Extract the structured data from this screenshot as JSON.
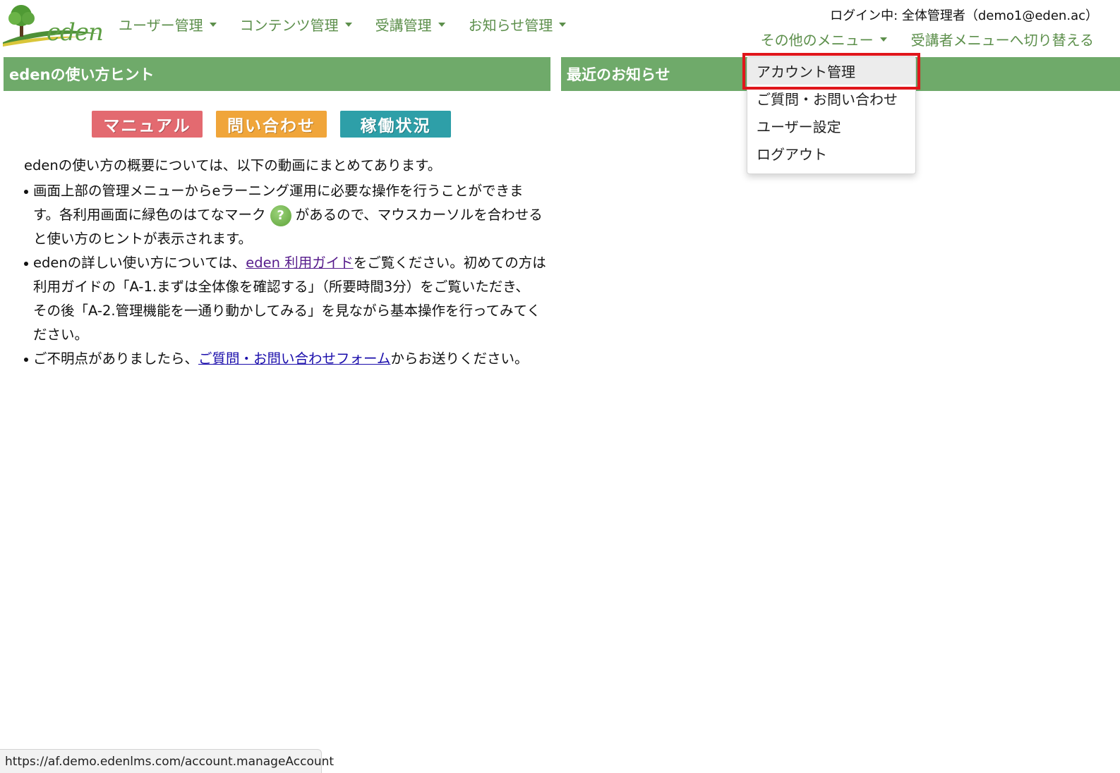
{
  "header": {
    "logo_text": "eden",
    "nav": [
      {
        "label": "ユーザー管理"
      },
      {
        "label": "コンテンツ管理"
      },
      {
        "label": "受講管理"
      },
      {
        "label": "お知らせ管理"
      }
    ],
    "login_status": "ログイン中: 全体管理者（demo1@eden.ac）",
    "other_menu_label": "その他のメニュー",
    "switch_menu_label": "受講者メニューへ切り替える"
  },
  "dropdown": {
    "items": [
      {
        "label": "アカウント管理"
      },
      {
        "label": "ご質問・お問い合わせ"
      },
      {
        "label": "ユーザー設定"
      },
      {
        "label": "ログアウト"
      }
    ]
  },
  "left_panel": {
    "title": "edenの使い方ヒント",
    "buttons": [
      {
        "label": "マニュアル",
        "color": "#e36a70"
      },
      {
        "label": "問い合わせ",
        "color": "#f0a53a"
      },
      {
        "label": "稼働状況",
        "color": "#2e9fa8"
      }
    ],
    "intro": "edenの使い方の概要については、以下の動画にまとめてあります。",
    "bullet1_a": "画面上部の管理メニューからeラーニング運用に必要な操作を行うことができます。各利用画面に緑色のはてなマーク",
    "bullet1_icon": "?",
    "bullet1_b": "があるので、マウスカーソルを合わせると使い方のヒントが表示されます。",
    "bullet2_a": "edenの詳しい使い方については、",
    "bullet2_link": "eden 利用ガイド",
    "bullet2_b": "をご覧ください。初めての方は利用ガイドの「A-1.まずは全体像を確認する」（所要時間3分）をご覧いただき、 その後「A-2.管理機能を一通り動かしてみる」を見ながら基本操作を行ってみてください。",
    "bullet3_a": "ご不明点がありましたら、",
    "bullet3_link": "ご質問・お問い合わせフォーム",
    "bullet3_b": "からお送りください。"
  },
  "right_panel": {
    "title": "最近のお知らせ"
  },
  "status_bar": {
    "url": "https://af.demo.edenlms.com/account.manageAccount"
  },
  "colors": {
    "panel_header": "#6faa6a",
    "nav_text": "#5c8f4b",
    "highlight": "#e0161b"
  }
}
